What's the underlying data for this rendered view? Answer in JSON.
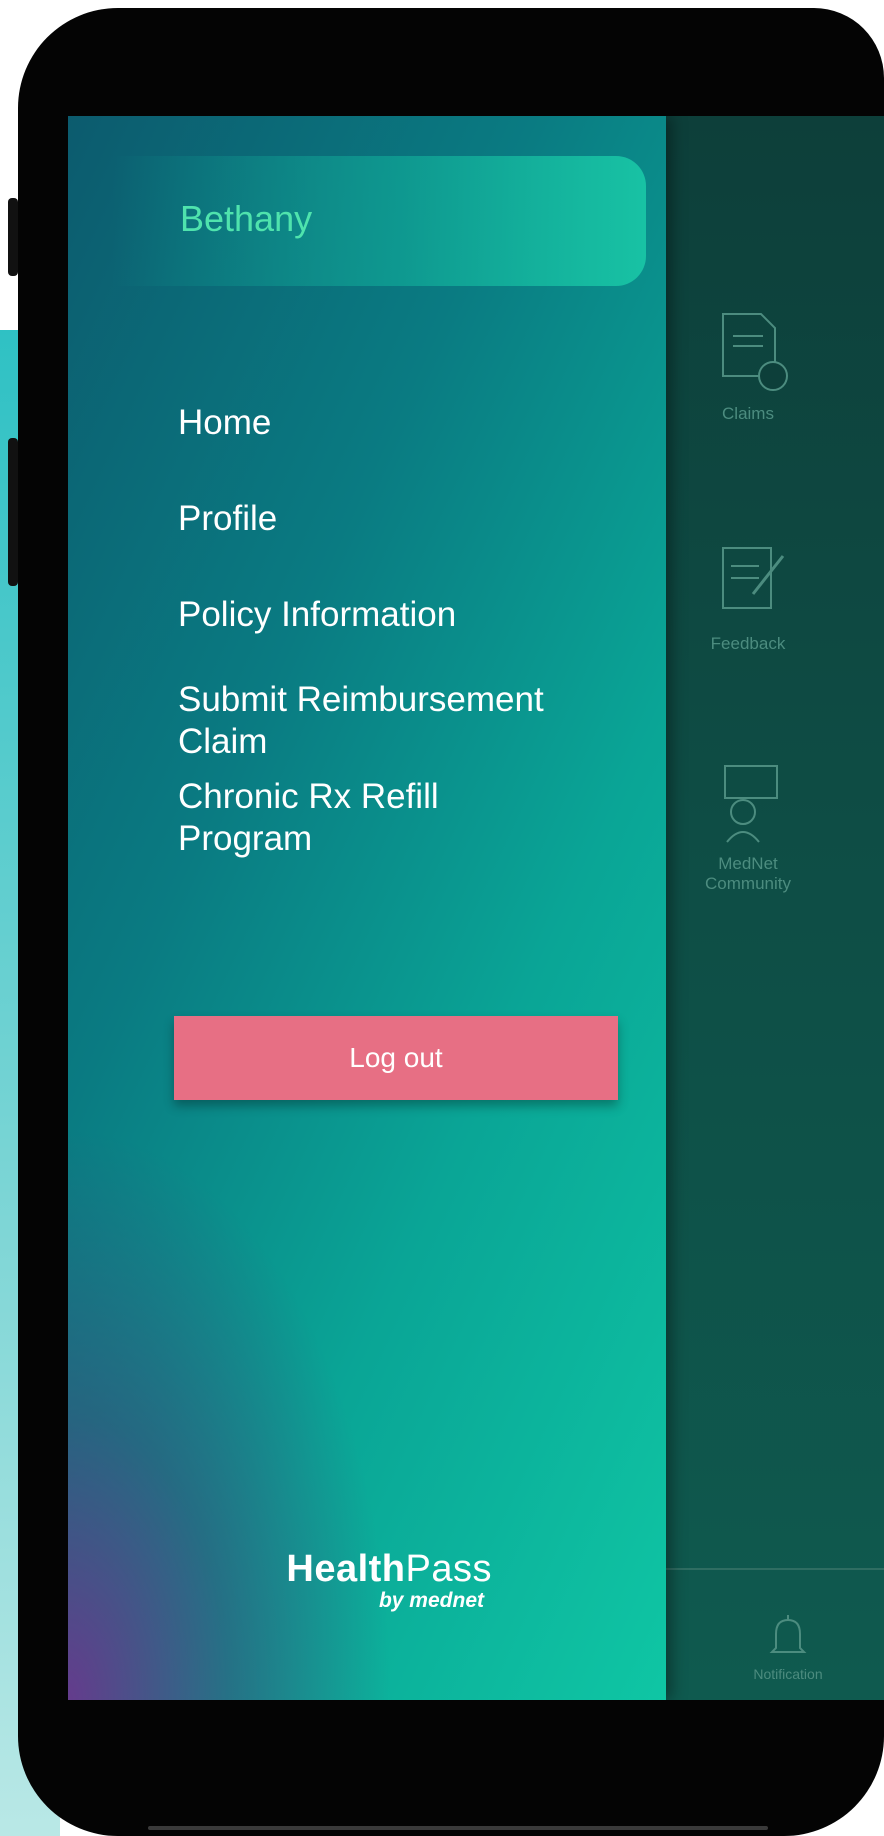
{
  "drawer": {
    "user_name": "Bethany",
    "menu": [
      {
        "label": "Home"
      },
      {
        "label": "Profile"
      },
      {
        "label": "Policy Information"
      },
      {
        "label": "Submit Reimbursement Claim"
      },
      {
        "label": "Chronic Rx Refill Program"
      }
    ],
    "logout_label": "Log out",
    "brand": {
      "main_bold": "Health",
      "main_light": "Pass",
      "sub": "by mednet"
    }
  },
  "background_app": {
    "tiles": [
      {
        "label": "Claims",
        "icon": "document-icon"
      },
      {
        "label": "Feedback",
        "icon": "pen-paper-icon"
      },
      {
        "label": "MedNet Community",
        "icon": "community-icon"
      }
    ],
    "notification_label": "Notification"
  },
  "colors": {
    "accent_green": "#4fe3ad",
    "logout_pink": "#e76f84",
    "drawer_start": "#0c5b6e",
    "drawer_end": "#0fc6a4"
  }
}
